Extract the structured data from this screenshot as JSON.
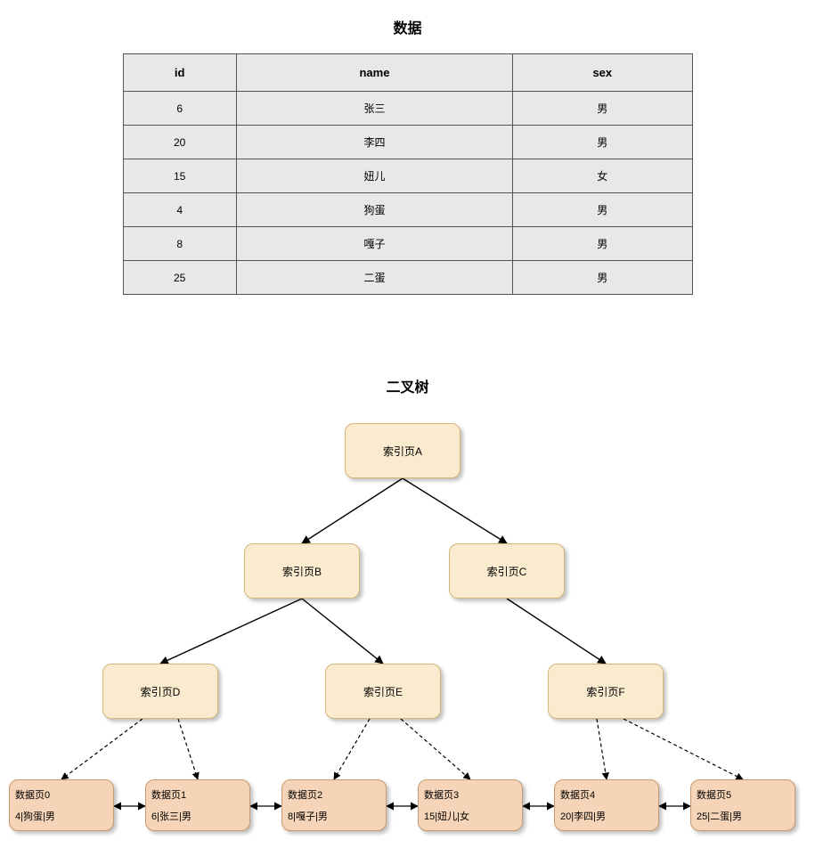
{
  "table": {
    "title": "数据",
    "headers": [
      "id",
      "name",
      "sex"
    ],
    "rows": [
      [
        "6",
        "张三",
        "男"
      ],
      [
        "20",
        "李四",
        "男"
      ],
      [
        "15",
        "妞儿",
        "女"
      ],
      [
        "4",
        "狗蛋",
        "男"
      ],
      [
        "8",
        "嘎子",
        "男"
      ],
      [
        "25",
        "二蛋",
        "男"
      ]
    ]
  },
  "tree": {
    "title": "二叉树",
    "index_nodes": {
      "A": "索引页A",
      "B": "索引页B",
      "C": "索引页C",
      "D": "索引页D",
      "E": "索引页E",
      "F": "索引页F"
    },
    "data_nodes": [
      {
        "title": "数据页0",
        "record": "4|狗蛋|男"
      },
      {
        "title": "数据页1",
        "record": "6|张三|男"
      },
      {
        "title": "数据页2",
        "record": "8|嘎子|男"
      },
      {
        "title": "数据页3",
        "record": "15|妞儿|女"
      },
      {
        "title": "数据页4",
        "record": "20|李四|男"
      },
      {
        "title": "数据页5",
        "record": "25|二蛋|男"
      }
    ]
  },
  "chart_data": {
    "type": "table",
    "title": "数据",
    "columns": [
      "id",
      "name",
      "sex"
    ],
    "rows": [
      [
        6,
        "张三",
        "男"
      ],
      [
        20,
        "李四",
        "男"
      ],
      [
        15,
        "妞儿",
        "女"
      ],
      [
        4,
        "狗蛋",
        "男"
      ],
      [
        8,
        "嘎子",
        "男"
      ],
      [
        25,
        "二蛋",
        "男"
      ]
    ],
    "tree": {
      "title": "二叉树",
      "root": "索引页A",
      "edges_solid": [
        [
          "索引页A",
          "索引页B"
        ],
        [
          "索引页A",
          "索引页C"
        ],
        [
          "索引页B",
          "索引页D"
        ],
        [
          "索引页B",
          "索引页E"
        ],
        [
          "索引页C",
          "索引页F"
        ]
      ],
      "edges_dashed": [
        [
          "索引页D",
          "数据页0"
        ],
        [
          "索引页D",
          "数据页1"
        ],
        [
          "索引页E",
          "数据页2"
        ],
        [
          "索引页E",
          "数据页3"
        ],
        [
          "索引页F",
          "数据页4"
        ],
        [
          "索引页F",
          "数据页5"
        ]
      ],
      "leaf_links": [
        [
          "数据页0",
          "数据页1"
        ],
        [
          "数据页1",
          "数据页2"
        ],
        [
          "数据页2",
          "数据页3"
        ],
        [
          "数据页3",
          "数据页4"
        ],
        [
          "数据页4",
          "数据页5"
        ]
      ],
      "leaves": {
        "数据页0": "4|狗蛋|男",
        "数据页1": "6|张三|男",
        "数据页2": "8|嘎子|男",
        "数据页3": "15|妞儿|女",
        "数据页4": "20|李四|男",
        "数据页5": "25|二蛋|男"
      }
    }
  }
}
